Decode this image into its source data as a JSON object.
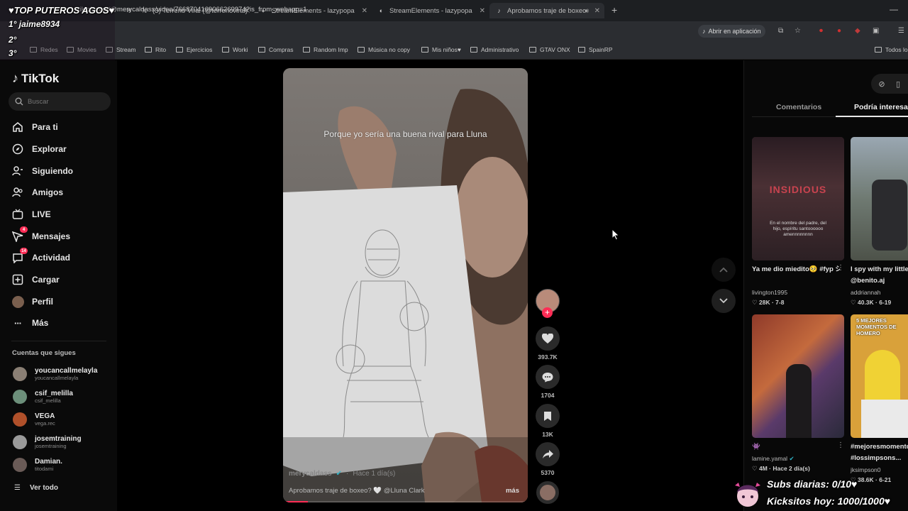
{
  "browser": {
    "tabs": [
      {
        "title": "♥TOP PUTEROS AGOS♥ - TikTok",
        "icon": "tiktok-icon",
        "active": false
      },
      {
        "title": "(3) Terreno Viral (@terrenoviral) / X",
        "icon": "x-logo-icon",
        "active": false
      },
      {
        "title": "StreamElements - lazypopa",
        "icon": "streamelements-icon",
        "active": false
      },
      {
        "title": "StreamElements - lazypopa",
        "icon": "streamelements-icon",
        "active": false
      },
      {
        "title": "Aprobamos traje de boxeo",
        "icon": "tiktok-icon",
        "active": true
      }
    ],
    "new_tab": "+",
    "url": "tiktok.com/@merycaldass/video/7668704169066269974?is_from_webapp=1",
    "open_app": "Abrir en aplicación",
    "bookmarks": [
      "Redes",
      "Movies",
      "Stream",
      "Rito",
      "Ejercicios",
      "Worki",
      "Compras",
      "Random Imp",
      "Música no copy",
      "Mis niños♥",
      "Administrativo",
      "GTAV ONX",
      "SpainRP"
    ],
    "bookmarks_right": "Todos los"
  },
  "overlay": {
    "title": "♥TOP PUTEROS AGOS♥",
    "ranks": [
      "1° jaime8934",
      "2°",
      "3°"
    ],
    "subs": "Subs diarias: 0/10♥",
    "kicks": "Kicksitos hoy: 1000/1000♥"
  },
  "sidebar": {
    "logo": "TikTok",
    "search_placeholder": "Buscar",
    "nav": [
      {
        "label": "Para ti",
        "icon": "home-icon"
      },
      {
        "label": "Explorar",
        "icon": "compass-icon"
      },
      {
        "label": "Siguiendo",
        "icon": "following-icon"
      },
      {
        "label": "Amigos",
        "icon": "friends-icon"
      },
      {
        "label": "LIVE",
        "icon": "live-icon"
      },
      {
        "label": "Mensajes",
        "icon": "messages-icon",
        "badge": "4"
      },
      {
        "label": "Actividad",
        "icon": "activity-icon",
        "badge": "14"
      },
      {
        "label": "Cargar",
        "icon": "upload-icon"
      },
      {
        "label": "Perfil",
        "icon": "profile-avatar"
      },
      {
        "label": "Más",
        "icon": "more-icon"
      }
    ],
    "following_heading": "Cuentas que sigues",
    "accounts": [
      {
        "name": "youcancallmelayla",
        "handle": "youcancallmelayla",
        "color": "#8a7f74"
      },
      {
        "name": "csif_melilla",
        "handle": "csif_melilla",
        "color": "#6c8f7a"
      },
      {
        "name": "VEGA",
        "handle": "vega.rec",
        "color": "#b0502a"
      },
      {
        "name": "josemtraining",
        "handle": "josemtraining",
        "color": "#9a9a9a"
      },
      {
        "name": "Damian.",
        "handle": "titodami",
        "color": "#6a5b57"
      }
    ],
    "see_all": "Ver todo"
  },
  "video": {
    "caption_overlay": "Porque yo sería una buena rival para Lluna",
    "author": "merycaldass",
    "time": "Hace 1 día(s)",
    "description": "Aprobamos traje de boxeo? 🤍 @Lluna Clark",
    "more": "más",
    "progress": 0.1
  },
  "actions": {
    "likes": "393.7K",
    "comments": "1704",
    "saves": "13K",
    "shares": "5370"
  },
  "right_panel": {
    "tabs": [
      "Comentarios",
      "Podría interesarte"
    ],
    "active_tab": 1,
    "videos": [
      {
        "title": "Ya me dio miedito🥺 #fyp シviral...",
        "author": "livington1995",
        "stats": "28K · 7-8",
        "overlay_title": "INSIDIOUS",
        "overlay_text": "En el nombre del padre, del hijo, espíritu santoooooo amennnnnnnn"
      },
      {
        "title": "I spy with my little",
        "author": "@benito.aj",
        "author2": "addriannah",
        "stats": "40.3K · 6-19"
      },
      {
        "title": "👾",
        "author": "lamine.yamal",
        "stats": "4M · Hace 2 día(s)"
      },
      {
        "title": "#mejoresmomentos",
        "title2": "#lossimpsons...",
        "author": "jksimpson0",
        "stats": "38.6K · 6-21",
        "overlay_text": "5 MEJORES MOMENTOS DE HOMERO"
      }
    ]
  }
}
